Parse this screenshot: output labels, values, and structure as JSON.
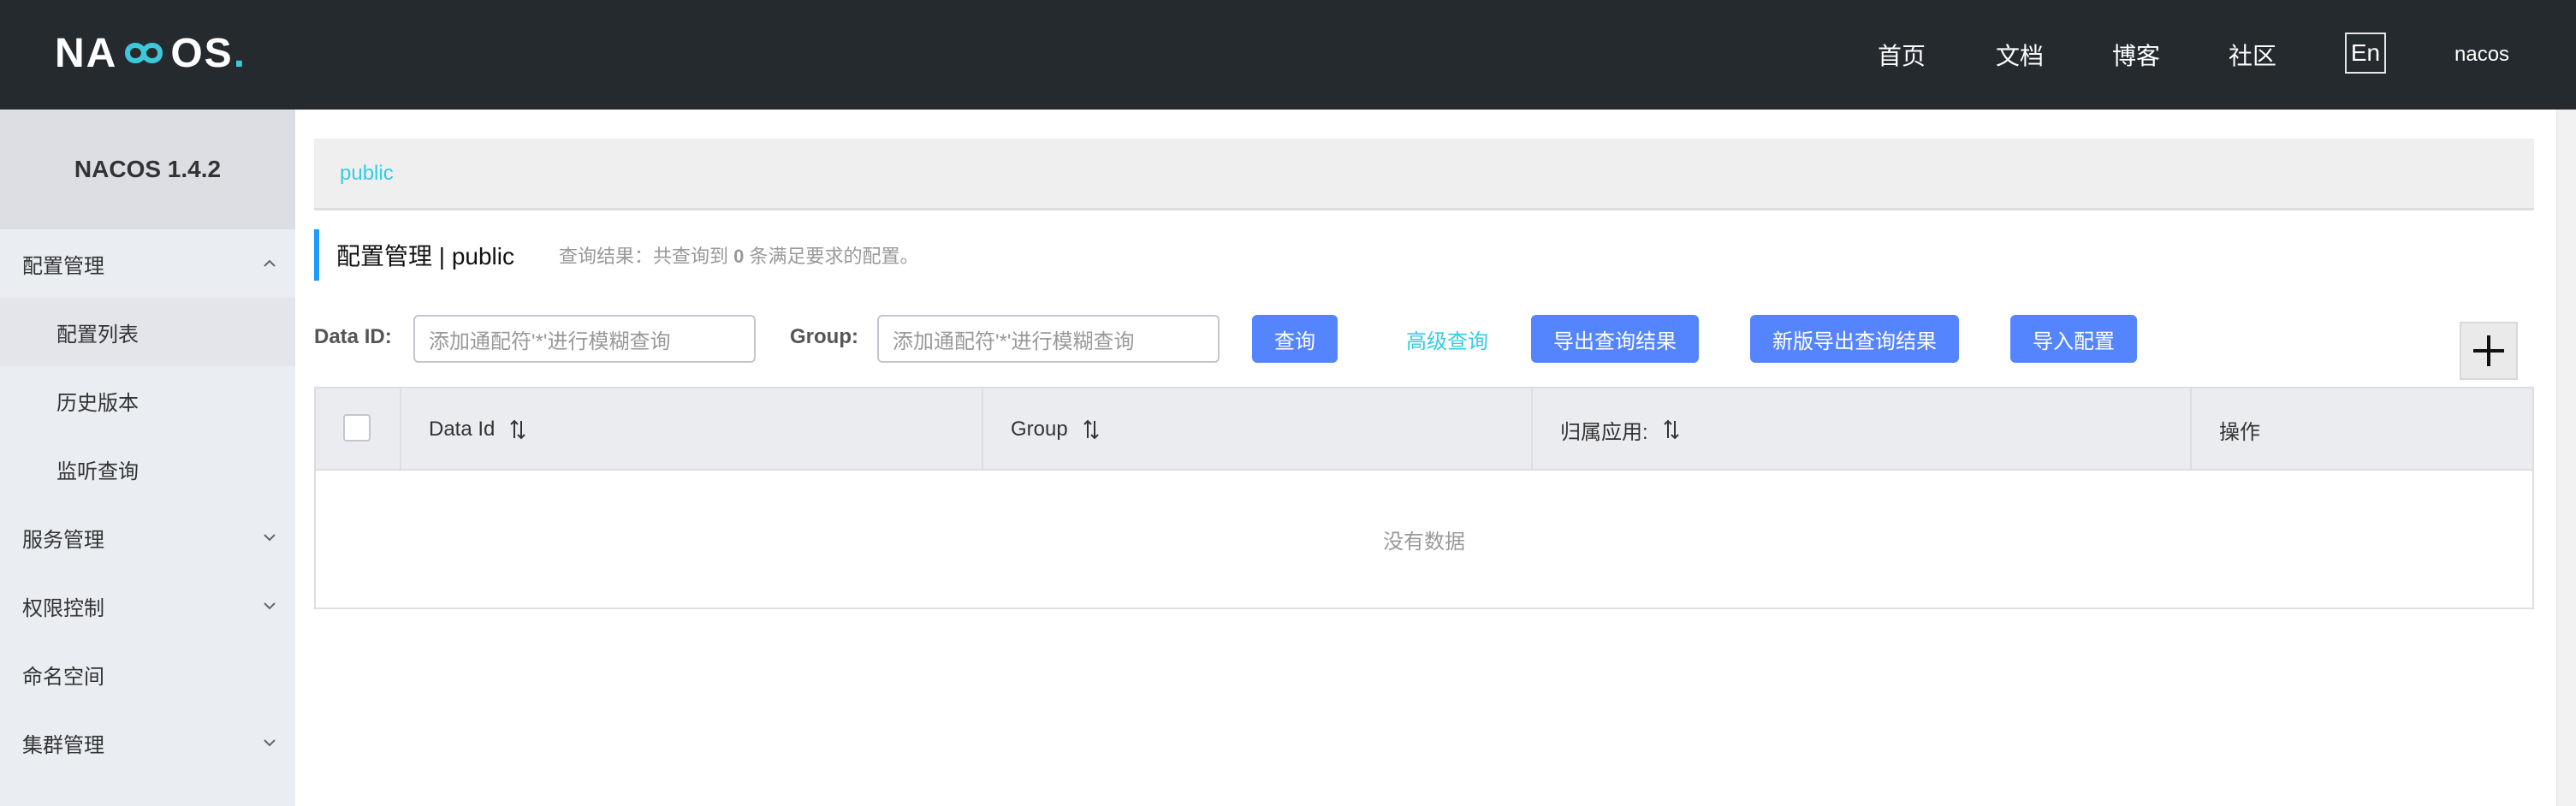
{
  "header": {
    "logo_text_a": "NA",
    "logo_text_b": "OS",
    "logo_dot": ".",
    "nav": [
      "首页",
      "文档",
      "博客",
      "社区"
    ],
    "lang": "En",
    "user": "nacos"
  },
  "sidebar": {
    "title": "NACOS 1.4.2",
    "items": [
      {
        "label": "配置管理",
        "expanded": true
      },
      {
        "label": "配置列表"
      },
      {
        "label": "历史版本"
      },
      {
        "label": "监听查询"
      },
      {
        "label": "服务管理"
      },
      {
        "label": "权限控制"
      },
      {
        "label": "命名空间"
      },
      {
        "label": "集群管理"
      }
    ]
  },
  "main": {
    "namespace": "public",
    "page_title": "配置管理 | public",
    "result_prefix": "查询结果：共查询到",
    "result_count": "0",
    "result_suffix": "条满足要求的配置。",
    "filters": {
      "data_id_label": "Data ID:",
      "data_id_placeholder": "添加通配符'*'进行模糊查询",
      "group_label": "Group:",
      "group_placeholder": "添加通配符'*'进行模糊查询"
    },
    "buttons": {
      "query": "查询",
      "advanced": "高级查询",
      "export": "导出查询结果",
      "export_new": "新版导出查询结果",
      "import": "导入配置"
    },
    "table": {
      "columns": [
        "Data Id",
        "Group",
        "归属应用:",
        "操作"
      ],
      "empty": "没有数据"
    }
  },
  "colors": {
    "header_bg": "#252a2f",
    "primary": "#5584ff",
    "link": "#33cde5",
    "accent_bar": "#209bfa"
  }
}
